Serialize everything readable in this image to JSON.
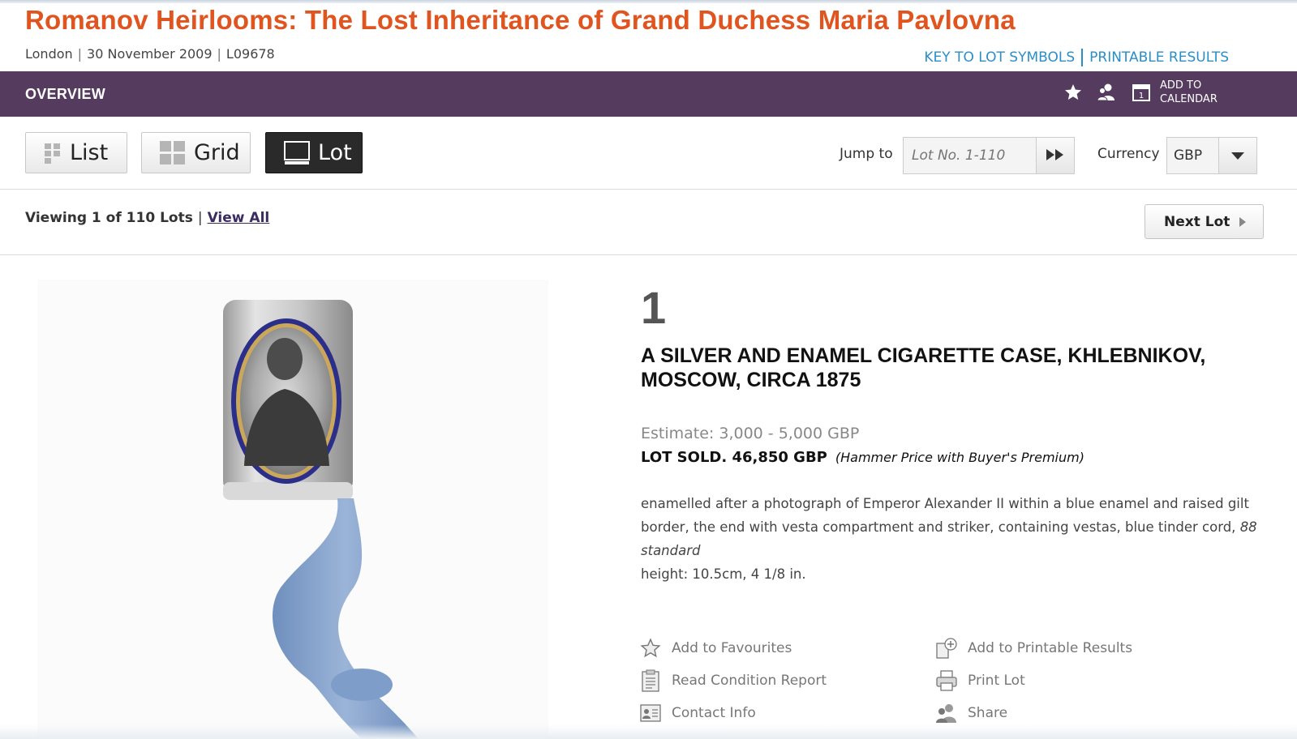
{
  "header": {
    "title": "Romanov Heirlooms: The Lost Inheritance of Grand Duchess Maria Pavlovna",
    "location": "London",
    "date": "30 November 2009",
    "sale_code": "L09678",
    "links": [
      "KEY TO LOT SYMBOLS",
      "PRINTABLE RESULTS"
    ],
    "link_color": "#2b8fc7",
    "title_color": "#e0541f"
  },
  "overview_bar": {
    "label": "OVERVIEW",
    "calendar_label": "ADD TO\nCALENDAR",
    "icons": [
      "star-icon",
      "user-add-icon",
      "calendar-icon"
    ],
    "background": "#553b5e"
  },
  "toolbar": {
    "views": [
      {
        "label": "List",
        "icon": "list-icon"
      },
      {
        "label": "Grid",
        "icon": "grid-icon"
      },
      {
        "label": "Lot",
        "icon": "lot-view-icon",
        "active": true
      }
    ],
    "jump_label": "Jump to",
    "jump_placeholder": "Lot No. 1-110",
    "currency_label": "Currency",
    "currency_value": "GBP"
  },
  "pager": {
    "viewing": "Viewing 1 of 110 Lots",
    "view_all": "View All",
    "next_label": "Next Lot"
  },
  "lot": {
    "number": "1",
    "title": "A SILVER AND ENAMEL CIGARETTE CASE, KHLEBNIKOV, MOSCOW, CIRCA 1875",
    "estimate": "Estimate: 3,000 - 5,000 GBP",
    "sold_label": "LOT SOLD. 46,850 GBP",
    "sold_note": "(Hammer Price with Buyer's Premium)",
    "description_text": "enamelled after a photograph of Emperor Alexander II within a blue enamel and raised gilt border, the end with vesta compartment and striker, containing vestas, blue tinder cord, ",
    "description_italic": "88 standard",
    "height": "height: 10.5cm, 4 1/8 in."
  },
  "actions": {
    "left": [
      "Add to Favourites",
      "Read Condition Report",
      "Contact Info"
    ],
    "right": [
      "Add to Printable Results",
      "Print Lot",
      "Share"
    ]
  }
}
